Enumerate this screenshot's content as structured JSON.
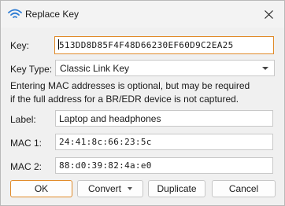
{
  "window": {
    "title": "Replace Key",
    "close_icon": "close-icon",
    "app_icon": "wifi-icon"
  },
  "form": {
    "key_label": "Key:",
    "key_value": "513DD8D85F4F48D66230EF60D9C2EA25",
    "key_type_label": "Key Type:",
    "key_type_value": "Classic Link Key",
    "info_line1": "Entering MAC addresses is optional, but may be required",
    "info_line2": "if the full address for a BR/EDR device is not captured.",
    "label_label": "Label:",
    "label_value": "Laptop and headphones",
    "mac1_label": "MAC 1:",
    "mac1_value": "24:41:8c:66:23:5c",
    "mac2_label": "MAC 2:",
    "mac2_value": "88:d0:39:82:4a:e0"
  },
  "buttons": {
    "ok": "OK",
    "convert": "Convert",
    "duplicate": "Duplicate",
    "cancel": "Cancel"
  },
  "colors": {
    "focus_accent": "#e08a28",
    "window_bg": "#f0f0f0",
    "wifi_icon": "#2b7bd4"
  }
}
